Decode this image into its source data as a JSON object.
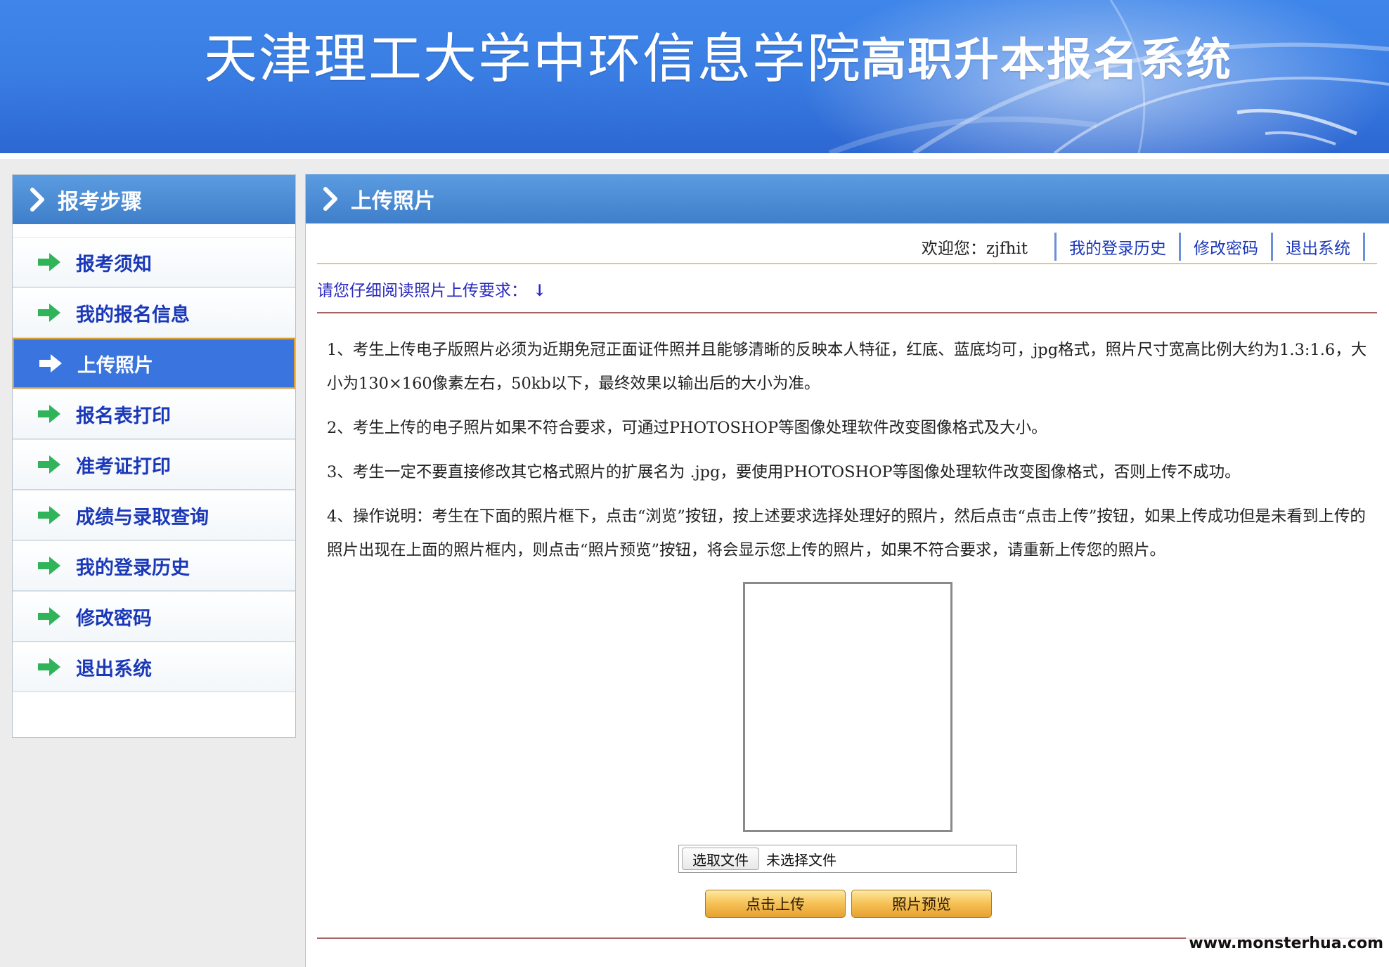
{
  "banner": {
    "title": "天津理工大学中环信息学院",
    "subtitle": "高职升本报名系统"
  },
  "sidebar": {
    "header": "报考步骤",
    "items": [
      {
        "label": "报考须知"
      },
      {
        "label": "我的报名信息"
      },
      {
        "label": "上传照片",
        "active": true
      },
      {
        "label": "报名表打印"
      },
      {
        "label": "准考证打印"
      },
      {
        "label": "成绩与录取查询"
      },
      {
        "label": "我的登录历史"
      },
      {
        "label": "修改密码"
      },
      {
        "label": "退出系统"
      }
    ]
  },
  "main": {
    "header": "上传照片",
    "userbar": {
      "welcome": "欢迎您：zjfhit",
      "links": [
        "我的登录历史",
        "修改密码",
        "退出系统"
      ]
    },
    "notice": "请您仔细阅读照片上传要求：",
    "notice_arrow": "↓",
    "instructions": [
      "1、考生上传电子版照片必须为近期免冠正面证件照并且能够清晰的反映本人特征，红底、蓝底均可，jpg格式，照片尺寸宽高比例大约为1.3:1.6，大小为130×160像素左右，50kb以下，最终效果以输出后的大小为准。",
      "2、考生上传的电子照片如果不符合要求，可通过PHOTOSHOP等图像处理软件改变图像格式及大小。",
      "3、考生一定不要直接修改其它格式照片的扩展名为 .jpg，要使用PHOTOSHOP等图像处理软件改变图像格式，否则上传不成功。",
      "4、操作说明：考生在下面的照片框下，点击“浏览”按钮，按上述要求选择处理好的照片，然后点击“点击上传”按钮，如果上传成功但是未看到上传的照片出现在上面的照片框内，则点击“照片预览”按钮，将会显示您上传的照片，如果不符合要求，请重新上传您的照片。"
    ],
    "file_input": {
      "button_label": "选取文件",
      "status": "未选择文件"
    },
    "upload_button": "点击上传",
    "preview_button": "照片预览"
  },
  "watermark": "www.monsterhua.com",
  "colors": {
    "banner_blue": "#3a7ee4",
    "header_blue": "#4a8ad4",
    "link_blue": "#1a38b8",
    "active_item": "#3a74de",
    "button_gold": "#f6c45a",
    "arrow_green": "#2fb45a"
  },
  "icons": {
    "header_chevron": "chevron-right-icon",
    "menu_arrow": "arrow-right-icon"
  }
}
